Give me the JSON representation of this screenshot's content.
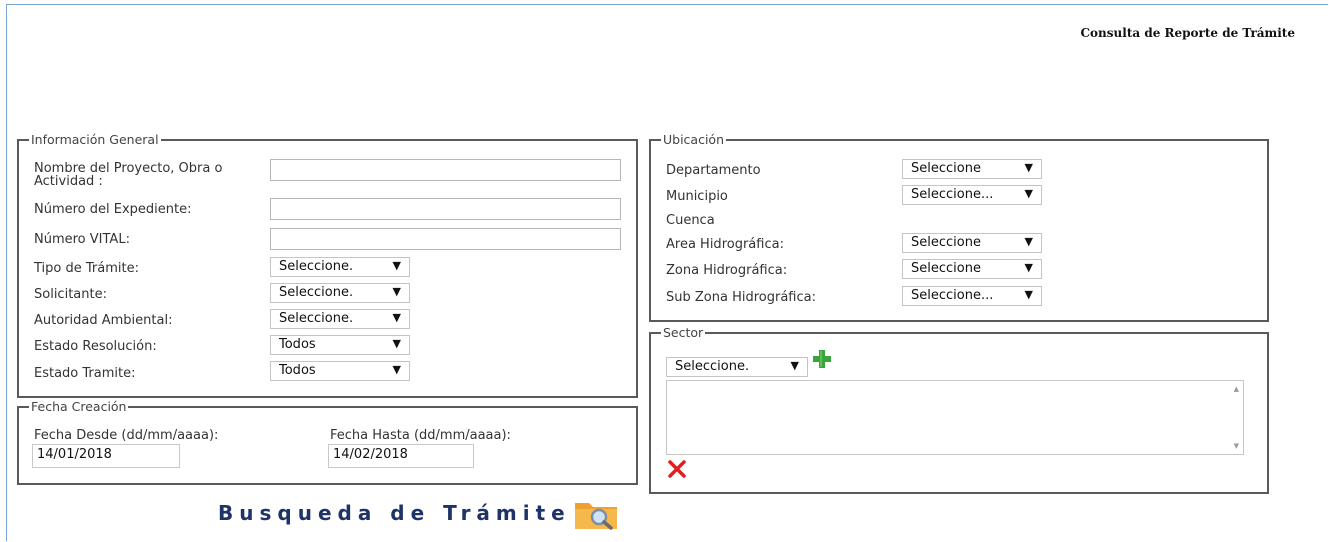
{
  "header": {
    "title": "Consulta de Reporte de Trámite"
  },
  "info_general": {
    "legend": "Información General",
    "fields": {
      "nombre": {
        "label": "Nombre del Proyecto, Obra o Actividad :",
        "value": ""
      },
      "expediente": {
        "label": "Número del Expediente:",
        "value": ""
      },
      "vital": {
        "label": "Número VITAL:",
        "value": ""
      },
      "tipo_tramite": {
        "label": "Tipo de Trámite:",
        "value": "Seleccione."
      },
      "solicitante": {
        "label": "Solicitante:",
        "value": "Seleccione."
      },
      "autoridad": {
        "label": "Autoridad Ambiental:",
        "value": "Seleccione."
      },
      "estado_resolucion": {
        "label": "Estado Resolución:",
        "value": "Todos"
      },
      "estado_tramite": {
        "label": "Estado Tramite:",
        "value": "Todos"
      }
    }
  },
  "fecha_creacion": {
    "legend": "Fecha Creación",
    "desde": {
      "label": "Fecha Desde (dd/mm/aaaa):",
      "value": "14/01/2018"
    },
    "hasta": {
      "label": "Fecha Hasta (dd/mm/aaaa):",
      "value": "14/02/2018"
    }
  },
  "ubicacion": {
    "legend": "Ubicación",
    "departamento": {
      "label": "Departamento",
      "value": "Seleccione"
    },
    "municipio": {
      "label": "Municipio",
      "value": "Seleccione..."
    },
    "cuenca_label": "Cuenca",
    "area_hidro": {
      "label": "Area Hidrográfica:",
      "value": "Seleccione"
    },
    "zona_hidro": {
      "label": "Zona Hidrográfica:",
      "value": "Seleccione"
    },
    "subzona_hidro": {
      "label": "Sub Zona Hidrográfica:",
      "value": "Seleccione..."
    }
  },
  "sector": {
    "legend": "Sector",
    "select_value": "Seleccione."
  },
  "search": {
    "label": "Busqueda de Trámite"
  },
  "colors": {
    "title_blue": "#1f3466",
    "add_green": "#3aa53a",
    "remove_red": "#e02020",
    "folder_orange": "#f0a030"
  }
}
